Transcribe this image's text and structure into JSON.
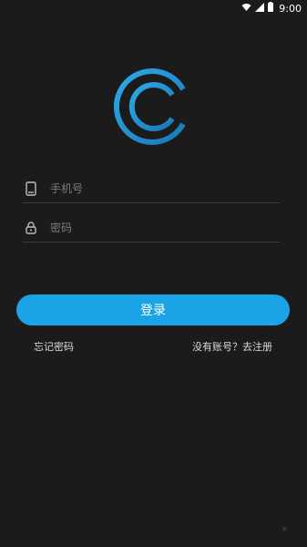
{
  "status_bar": {
    "time": "9:00",
    "icons": [
      "wifi-icon",
      "signal-icon",
      "battery-icon"
    ]
  },
  "colors": {
    "background": "#1b1b1b",
    "accent": "#1aa4e6",
    "logo_ring": "#1f8fcf"
  },
  "form": {
    "phone_placeholder": "手机号",
    "password_placeholder": "密码",
    "phone_value": "",
    "password_value": ""
  },
  "actions": {
    "login_label": "登录",
    "forgot_password": "忘记密码",
    "register": "没有账号？去注册"
  }
}
